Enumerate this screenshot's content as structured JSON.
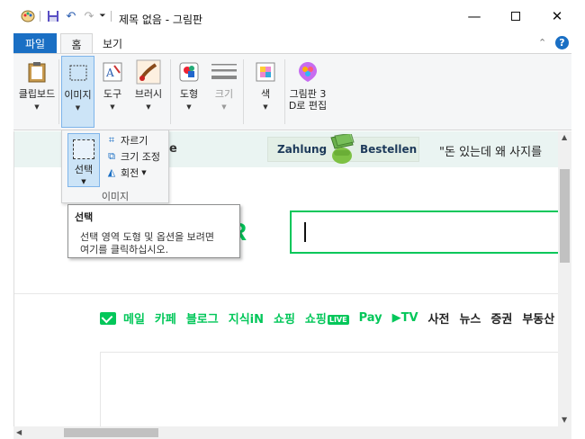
{
  "window": {
    "title": "제목 없음 - 그림판",
    "minimize_icon": "minimize-icon",
    "maximize_icon": "maximize-icon",
    "close_icon": "close-icon"
  },
  "quick_access": {
    "icons": [
      "paint-app-icon",
      "save-icon",
      "undo-icon",
      "redo-icon",
      "customize-dropdown-icon"
    ]
  },
  "menu": {
    "file": "파일",
    "home": "홈",
    "view": "보기",
    "file_color": "#1a6fc4"
  },
  "ribbon": {
    "clipboard": "클립보드",
    "image": "이미지",
    "tools": "도구",
    "brushes": "브러시",
    "shapes": "도형",
    "size": "크기",
    "color": "색",
    "paint3d_line1": "그림판 3",
    "paint3d_line2": "D로 편집"
  },
  "image_dropdown": {
    "select": "선택",
    "crop": "자르기",
    "resize": "크기 조정",
    "rotate": "회전",
    "group_label": "이미지"
  },
  "tooltip": {
    "title": "선택",
    "body_line1": "선택 영역 도형 및 옵션을 보려면",
    "body_line2": "여기를 클릭하십시오."
  },
  "canvas": {
    "banner_fragment": "e",
    "ad_left": "Zahlung",
    "ad_right": "Bestellen",
    "quote": "\"돈 있는데 왜 사지를",
    "logo_fragment": "R",
    "accent_color": "#03c75a",
    "services": [
      "메일",
      "카페",
      "블로그",
      "지식iN",
      "쇼핑",
      "쇼핑",
      "Pay",
      "TV",
      "사전",
      "뉴스",
      "증권",
      "부동산"
    ],
    "live_badge": "LIVE"
  }
}
